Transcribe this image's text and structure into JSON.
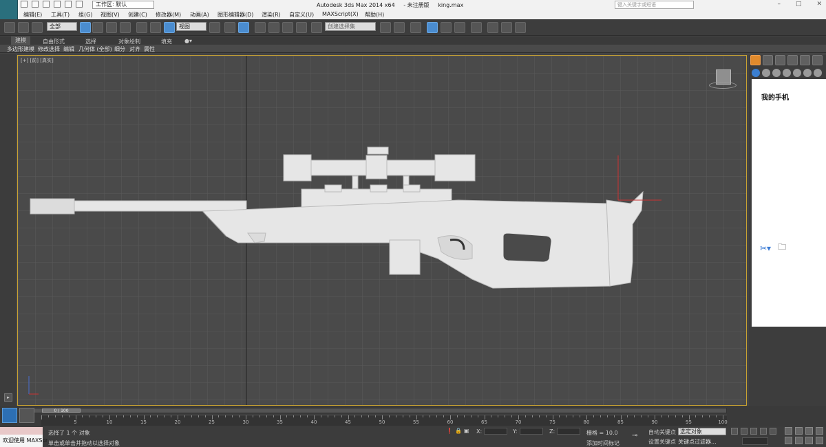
{
  "title_bar": {
    "workspace_label": "工作区: 默认",
    "app_name": "Autodesk 3ds Max  2014 x64",
    "status": "- 未注册版",
    "file_name": "king.max",
    "search_placeholder": "键入关键字或短语",
    "window_controls": [
      "–",
      "□",
      "✕"
    ]
  },
  "menu": [
    "编辑(E)",
    "工具(T)",
    "组(G)",
    "视图(V)",
    "创建(C)",
    "修改器(M)",
    "动画(A)",
    "图形编辑器(D)",
    "渲染(R)",
    "自定义(U)",
    "MAXScript(X)",
    "帮助(H)"
  ],
  "toolbar": {
    "filter_value": "全部",
    "coord_value": "视图",
    "selection_set_placeholder": "创建选择集"
  },
  "ribbon_tabs": [
    {
      "label": "建模",
      "active": true
    },
    {
      "label": "自由形式",
      "active": false
    },
    {
      "label": "选择",
      "active": false
    },
    {
      "label": "对象绘制",
      "active": false
    },
    {
      "label": "填充",
      "active": false
    }
  ],
  "ribbon_items": [
    "多边形建模",
    "修改选择",
    "编辑",
    "几何体 (全部)",
    "细分",
    "对齐",
    "属性"
  ],
  "viewport": {
    "label": "[+] [前] [真实]",
    "grid_color": "#5a5a5a",
    "frame_color": "#c8a232"
  },
  "command_panel": {
    "panel_title": "我的手机"
  },
  "timeline": {
    "range_label": "0 / 100",
    "ticks": [
      0,
      5,
      10,
      15,
      20,
      25,
      30,
      35,
      40,
      45,
      50,
      55,
      60,
      65,
      70,
      75,
      80,
      85,
      90,
      95,
      100
    ]
  },
  "status": {
    "welcome": "欢迎使用 MAXScr",
    "selection_info": "选择了 1 个 对象",
    "prompt": "单击或单击并拖动以选择对象",
    "x_label": "X:",
    "y_label": "Y:",
    "z_label": "Z:",
    "grid_label": "栅格 = 10.0",
    "add_time_tag": "添加时间标记",
    "auto_key": "自动关键点",
    "set_key": "设置关键点",
    "selected_dropdown": "选定对象",
    "key_filters": "关键点过滤器..."
  }
}
